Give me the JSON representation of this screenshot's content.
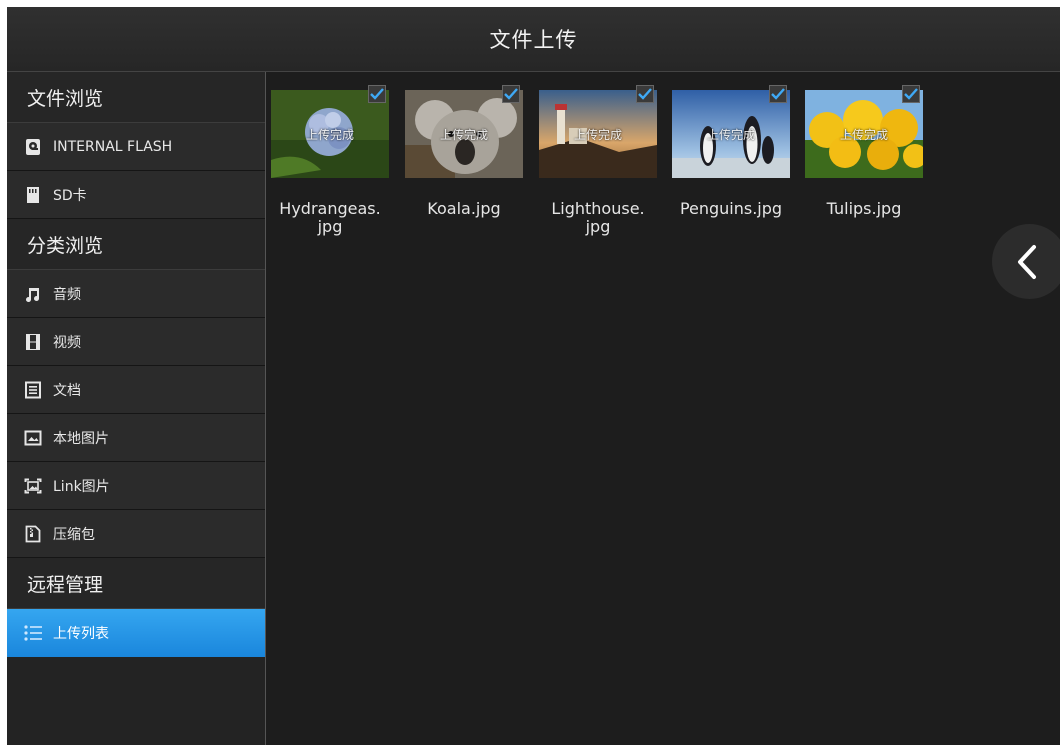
{
  "header": {
    "title": "文件上传"
  },
  "sidebar": {
    "sections": [
      {
        "title": "文件浏览"
      },
      {
        "title": "分类浏览"
      },
      {
        "title": "远程管理"
      }
    ],
    "items": [
      {
        "label": "INTERNAL FLASH",
        "icon": "internal-flash-icon"
      },
      {
        "label": "SD卡",
        "icon": "sd-card-icon"
      },
      {
        "label": "音频",
        "icon": "music-note-icon"
      },
      {
        "label": "视频",
        "icon": "film-icon"
      },
      {
        "label": "文档",
        "icon": "document-icon"
      },
      {
        "label": "本地图片",
        "icon": "image-icon"
      },
      {
        "label": "Link图片",
        "icon": "link-image-icon"
      },
      {
        "label": "压缩包",
        "icon": "zip-file-icon"
      },
      {
        "label": "上传列表",
        "icon": "list-icon",
        "selected": true
      }
    ]
  },
  "files": [
    {
      "name": "Hydrangeas.\njpg",
      "status": "上传完成",
      "checked": true
    },
    {
      "name": "Koala.jpg",
      "status": "上传完成",
      "checked": true
    },
    {
      "name": "Lighthouse.\njpg",
      "status": "上传完成",
      "checked": true
    },
    {
      "name": "Penguins.jpg",
      "status": "上传完成",
      "checked": true
    },
    {
      "name": "Tulips.jpg",
      "status": "上传完成",
      "checked": true
    }
  ],
  "colors": {
    "accent": "#1a86dc",
    "check": "#3fa9f5",
    "background": "#1d1d1d"
  }
}
